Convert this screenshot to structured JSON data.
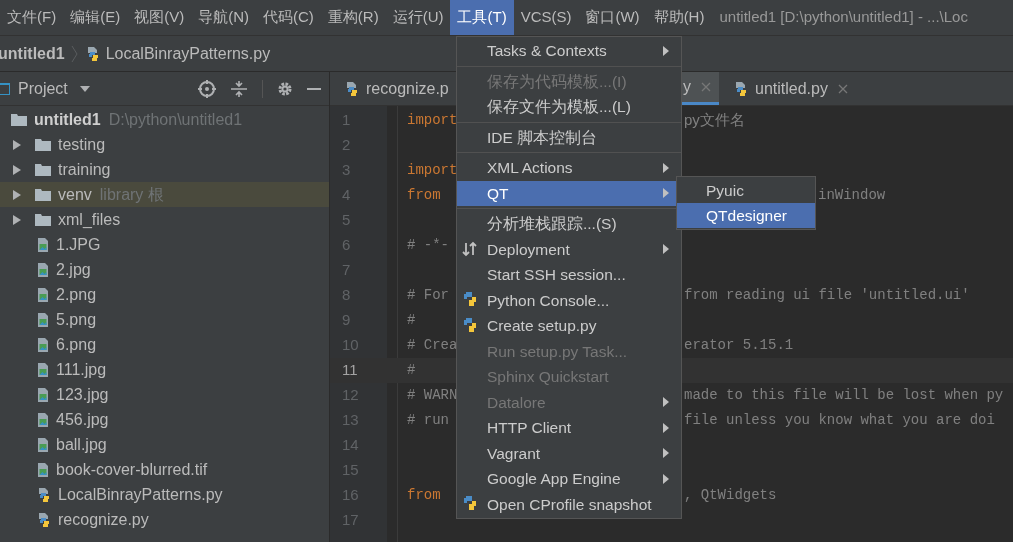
{
  "menu_bar": [
    {
      "label": "文件(F)",
      "selected": false
    },
    {
      "label": "编辑(E)",
      "selected": false
    },
    {
      "label": "视图(V)",
      "selected": false
    },
    {
      "label": "导航(N)",
      "selected": false
    },
    {
      "label": "代码(C)",
      "selected": false
    },
    {
      "label": "重构(R)",
      "selected": false
    },
    {
      "label": "运行(U)",
      "selected": false
    },
    {
      "label": "工具(T)",
      "selected": true
    },
    {
      "label": "VCS(S)",
      "selected": false
    },
    {
      "label": "窗口(W)",
      "selected": false
    },
    {
      "label": "帮助(H)",
      "selected": false
    }
  ],
  "window": {
    "title": "untitled1 [D:\\python\\untitled1] - ...\\Loc"
  },
  "breadcrumb": [
    {
      "label": "untitled1",
      "kind": "project"
    },
    {
      "label": "LocalBinrayPatterns.py",
      "kind": "python"
    }
  ],
  "project_panel": {
    "title": "Project",
    "tree": [
      {
        "label": "untitled1",
        "hint": "D:\\python\\untitled1",
        "kind": "root",
        "selected": false,
        "children": [
          {
            "label": "testing",
            "kind": "folder",
            "expanded": false,
            "selected": false
          },
          {
            "label": "training",
            "kind": "folder",
            "expanded": false,
            "selected": false
          },
          {
            "label": "venv",
            "hint": "library 根",
            "kind": "folder",
            "expanded": false,
            "selected": true
          },
          {
            "label": "xml_files",
            "kind": "folder",
            "expanded": false,
            "selected": false
          },
          {
            "label": "1.JPG",
            "kind": "image",
            "selected": false
          },
          {
            "label": "2.jpg",
            "kind": "image",
            "selected": false
          },
          {
            "label": "2.png",
            "kind": "image",
            "selected": false
          },
          {
            "label": "5.png",
            "kind": "image",
            "selected": false
          },
          {
            "label": "6.png",
            "kind": "image",
            "selected": false
          },
          {
            "label": "111.jpg",
            "kind": "image",
            "selected": false
          },
          {
            "label": "123.jpg",
            "kind": "image",
            "selected": false
          },
          {
            "label": "456.jpg",
            "kind": "image",
            "selected": false
          },
          {
            "label": "ball.jpg",
            "kind": "image",
            "selected": false
          },
          {
            "label": "book-cover-blurred.tif",
            "kind": "image",
            "selected": false
          },
          {
            "label": "LocalBinrayPatterns.py",
            "kind": "python",
            "selected": false
          },
          {
            "label": "recognize.py",
            "kind": "python",
            "selected": false
          }
        ]
      }
    ]
  },
  "editor_tabs": [
    {
      "label": "recognize.p",
      "selected": false,
      "kind": "python"
    },
    {
      "label": "y",
      "selected": true,
      "kind": "hidden"
    },
    {
      "label": "untitled.py",
      "selected": false,
      "kind": "python"
    }
  ],
  "code_lines": [
    {
      "number": "1",
      "left": "import",
      "right": "py文件名",
      "current": false,
      "kind": "split"
    },
    {
      "number": "2",
      "current": false,
      "kind": "split"
    },
    {
      "number": "3",
      "left": "import",
      "current": false,
      "kind": "split"
    },
    {
      "number": "4",
      "left": "from",
      "right": "inWindow",
      "current": false,
      "kind": "split-wide"
    },
    {
      "number": "5",
      "current": false,
      "kind": "split"
    },
    {
      "number": "6",
      "left": "# -*-",
      "current": false,
      "kind": "split"
    },
    {
      "number": "7",
      "current": false,
      "kind": "split"
    },
    {
      "number": "8",
      "left": "# For",
      "right": "from reading ui file 'untitled.ui'",
      "current": false,
      "kind": "split"
    },
    {
      "number": "9",
      "left": "#",
      "current": false,
      "kind": "split"
    },
    {
      "number": "10",
      "left": "# Crea",
      "right": "erator 5.15.1",
      "current": false,
      "kind": "split"
    },
    {
      "number": "11",
      "left": "#",
      "current": true,
      "kind": "split"
    },
    {
      "number": "12",
      "left": "# WARN",
      "right": "made to this file will be lost when py",
      "current": false,
      "kind": "split"
    },
    {
      "number": "13",
      "left": "# run",
      "right": "file unless you know what you are doi",
      "current": false,
      "kind": "split"
    },
    {
      "number": "14",
      "current": false,
      "kind": "split"
    },
    {
      "number": "15",
      "current": false,
      "kind": "split"
    },
    {
      "number": "16",
      "left": "from",
      "right": ", QtWidgets",
      "current": false,
      "kind": "split"
    },
    {
      "number": "17",
      "current": false,
      "kind": "split"
    }
  ],
  "tools_menu": [
    {
      "kind": "item",
      "label": "Tasks & Contexts",
      "submenu": true,
      "disabled": false,
      "selected": false
    },
    {
      "kind": "separator"
    },
    {
      "kind": "item",
      "label": "保存为代码模板...(I)",
      "submenu": false,
      "disabled": true,
      "selected": false
    },
    {
      "kind": "item",
      "label": "保存文件为模板...(L)",
      "submenu": false,
      "disabled": false,
      "selected": false
    },
    {
      "kind": "separator"
    },
    {
      "kind": "item",
      "label": "IDE 脚本控制台",
      "submenu": false,
      "disabled": false,
      "selected": false
    },
    {
      "kind": "separator"
    },
    {
      "kind": "item",
      "label": "XML Actions",
      "submenu": true,
      "disabled": false,
      "selected": false
    },
    {
      "kind": "item",
      "label": "QT",
      "submenu": true,
      "disabled": false,
      "selected": true
    },
    {
      "kind": "separator"
    },
    {
      "kind": "item",
      "label": "分析堆栈跟踪...(S)",
      "submenu": false,
      "disabled": false,
      "selected": false
    },
    {
      "kind": "arrows-item",
      "label": "Deployment",
      "submenu": true,
      "disabled": false,
      "selected": false
    },
    {
      "kind": "item",
      "label": "Start SSH session...",
      "submenu": false,
      "disabled": false,
      "selected": false
    },
    {
      "kind": "python-item",
      "label": "Python Console...",
      "submenu": false,
      "disabled": false,
      "selected": false
    },
    {
      "kind": "python-item",
      "label": "Create setup.py",
      "submenu": false,
      "disabled": false,
      "selected": false
    },
    {
      "kind": "item",
      "label": "Run setup.py Task...",
      "submenu": false,
      "disabled": true,
      "selected": false
    },
    {
      "kind": "item",
      "label": "Sphinx Quickstart",
      "submenu": false,
      "disabled": true,
      "selected": false
    },
    {
      "kind": "item",
      "label": "Datalore",
      "submenu": true,
      "disabled": true,
      "selected": false
    },
    {
      "kind": "item",
      "label": "HTTP Client",
      "submenu": true,
      "disabled": false,
      "selected": false
    },
    {
      "kind": "item",
      "label": "Vagrant",
      "submenu": true,
      "disabled": false,
      "selected": false
    },
    {
      "kind": "item",
      "label": "Google App Engine",
      "submenu": true,
      "disabled": false,
      "selected": false
    },
    {
      "kind": "python-item",
      "label": "Open CProfile snapshot",
      "submenu": false,
      "disabled": false,
      "selected": false
    }
  ],
  "qt_submenu": [
    {
      "label": "Pyuic",
      "selected": false
    },
    {
      "label": "QTdesigner",
      "selected": true
    }
  ]
}
